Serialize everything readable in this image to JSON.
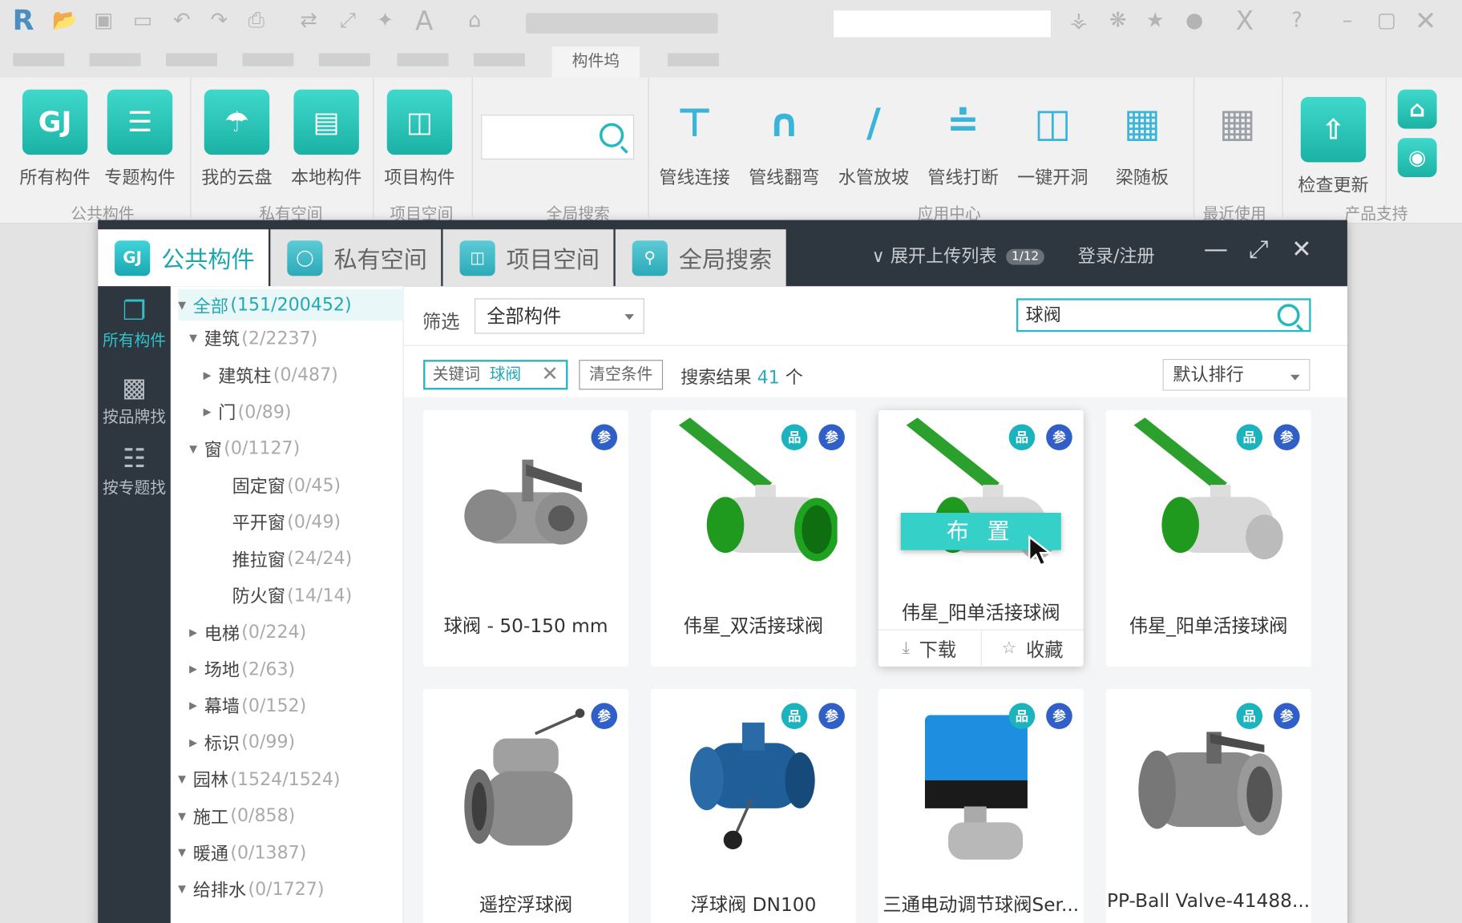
{
  "titlebar": {
    "tab_active": "构件坞",
    "search_value": ""
  },
  "ribbon": {
    "buttons": [
      {
        "label": "所有构件",
        "icon": "GJ"
      },
      {
        "label": "专题构件",
        "icon": "list-grid-icon"
      },
      {
        "label": "我的云盘",
        "icon": "cloud-drive-icon"
      },
      {
        "label": "本地构件",
        "icon": "hard-drive-icon"
      },
      {
        "label": "项目构件",
        "icon": "project-icon"
      }
    ],
    "tools": [
      {
        "label": "管线连接",
        "icon": "pipe-connect-icon"
      },
      {
        "label": "管线翻弯",
        "icon": "pipe-bend-icon"
      },
      {
        "label": "水管放坡",
        "icon": "pipe-slope-icon"
      },
      {
        "label": "管线打断",
        "icon": "pipe-break-icon"
      },
      {
        "label": "一键开洞",
        "icon": "open-hole-icon"
      },
      {
        "label": "梁随板",
        "icon": "beam-slab-icon"
      }
    ],
    "update_label": "检查更新",
    "groups": [
      "公共构件",
      "私有空间",
      "项目空间",
      "全局搜索",
      "应用中心",
      "最近使用",
      "产品支持"
    ]
  },
  "dialog": {
    "tabs": [
      {
        "label": "公共构件",
        "icon": "GJ"
      },
      {
        "label": "私有空间",
        "icon": "private-space-icon"
      },
      {
        "label": "项目空间",
        "icon": "project-space-icon"
      },
      {
        "label": "全局搜索",
        "icon": "global-search-icon"
      }
    ],
    "upload_list": "展开上传列表",
    "upload_badge": "1/12",
    "login": "登录/注册"
  },
  "leftnav": [
    {
      "label": "所有构件",
      "icon": "stack-icon"
    },
    {
      "label": "按品牌找",
      "icon": "brand-icon"
    },
    {
      "label": "按专题找",
      "icon": "topic-icon"
    }
  ],
  "tree": [
    {
      "name": "全部",
      "count": "(151/200452)"
    },
    {
      "name": "建筑",
      "count": "(2/2237)"
    },
    {
      "name": "建筑柱",
      "count": "(0/487)"
    },
    {
      "name": "门",
      "count": "(0/89)"
    },
    {
      "name": "窗",
      "count": "(0/1127)"
    },
    {
      "name": "固定窗",
      "count": "(0/45)"
    },
    {
      "name": "平开窗",
      "count": "(0/49)"
    },
    {
      "name": "推拉窗",
      "count": "(24/24)"
    },
    {
      "name": "防火窗",
      "count": "(14/14)"
    },
    {
      "name": "电梯",
      "count": "(0/224)"
    },
    {
      "name": "场地",
      "count": "(2/63)"
    },
    {
      "name": "幕墙",
      "count": "(0/152)"
    },
    {
      "name": "标识",
      "count": "(0/99)"
    },
    {
      "name": "园林",
      "count": "(1524/1524)"
    },
    {
      "name": "施工",
      "count": "(0/858)"
    },
    {
      "name": "暖通",
      "count": "(0/1387)"
    },
    {
      "name": "给排水",
      "count": "(0/1727)"
    }
  ],
  "filter": {
    "label": "筛选",
    "value": "全部构件"
  },
  "search": {
    "value": "球阀"
  },
  "chips": {
    "keyword_label": "关键词",
    "keyword_value": "球阀",
    "clear": "清空条件"
  },
  "results": {
    "prefix": "搜索结果",
    "count": "41",
    "suffix": "个"
  },
  "sort": {
    "value": "默认排行"
  },
  "badges": {
    "pin": "品",
    "can": "参"
  },
  "hover": {
    "place": "布 置",
    "download": "下载",
    "favorite": "收藏"
  },
  "cards": [
    {
      "name": "球阀 - 50-150 mm"
    },
    {
      "name": "伟星_双活接球阀"
    },
    {
      "name": "伟星_阳单活接球阀"
    },
    {
      "name": "伟星_阳单活接球阀"
    },
    {
      "name": "遥控浮球阀"
    },
    {
      "name": "浮球阀 DN100"
    },
    {
      "name": "三通电动调节球阀Ser..."
    },
    {
      "name": "PP-Ball Valve-41488..."
    }
  ]
}
